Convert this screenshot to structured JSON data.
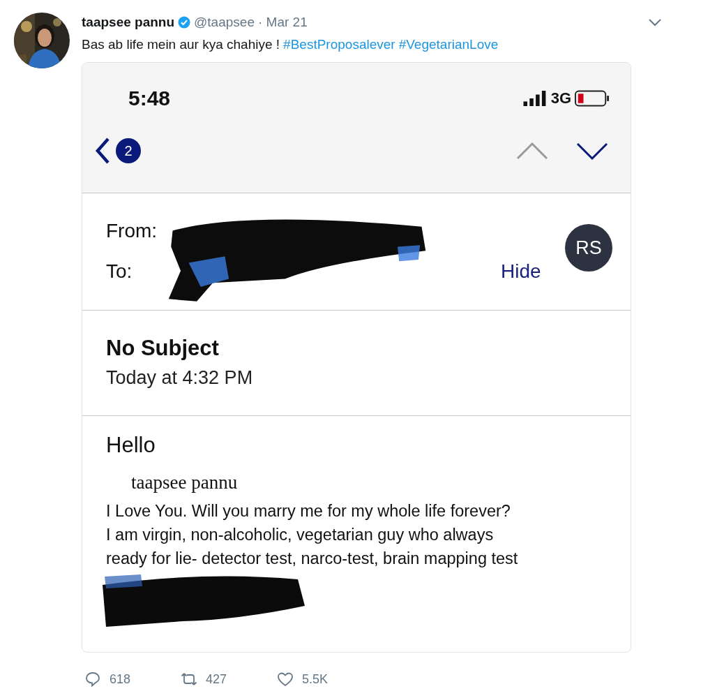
{
  "tweet": {
    "author": "taapsee pannu",
    "verified": true,
    "handle": "@taapsee",
    "date": "· Mar 21",
    "text": "Bas ab life mein aur kya chahiye !",
    "hashtags": [
      "#BestProposalever",
      "#VegetarianLove"
    ]
  },
  "email": {
    "status_bar": {
      "time": "5:48",
      "network": "3G"
    },
    "nav": {
      "unread_count": "2"
    },
    "header": {
      "from_label": "From:",
      "to_label": "To:",
      "avatar_initials": "RS",
      "hide_link": "Hide"
    },
    "subject": "No Subject",
    "date": "Today at 4:32 PM",
    "body": {
      "greeting": "Hello",
      "name_line": "taapsee pannu",
      "lines": [
        "I Love You. Will you marry me for my whole life forever?",
        "I am virgin, non-alcoholic, vegetarian guy who always",
        "ready for lie- detector test, narco-test, brain mapping test"
      ]
    }
  },
  "actions": [
    {
      "kind": "reply",
      "count": "618"
    },
    {
      "kind": "retweet",
      "count": "427"
    },
    {
      "kind": "like",
      "count": "5.5K"
    }
  ]
}
